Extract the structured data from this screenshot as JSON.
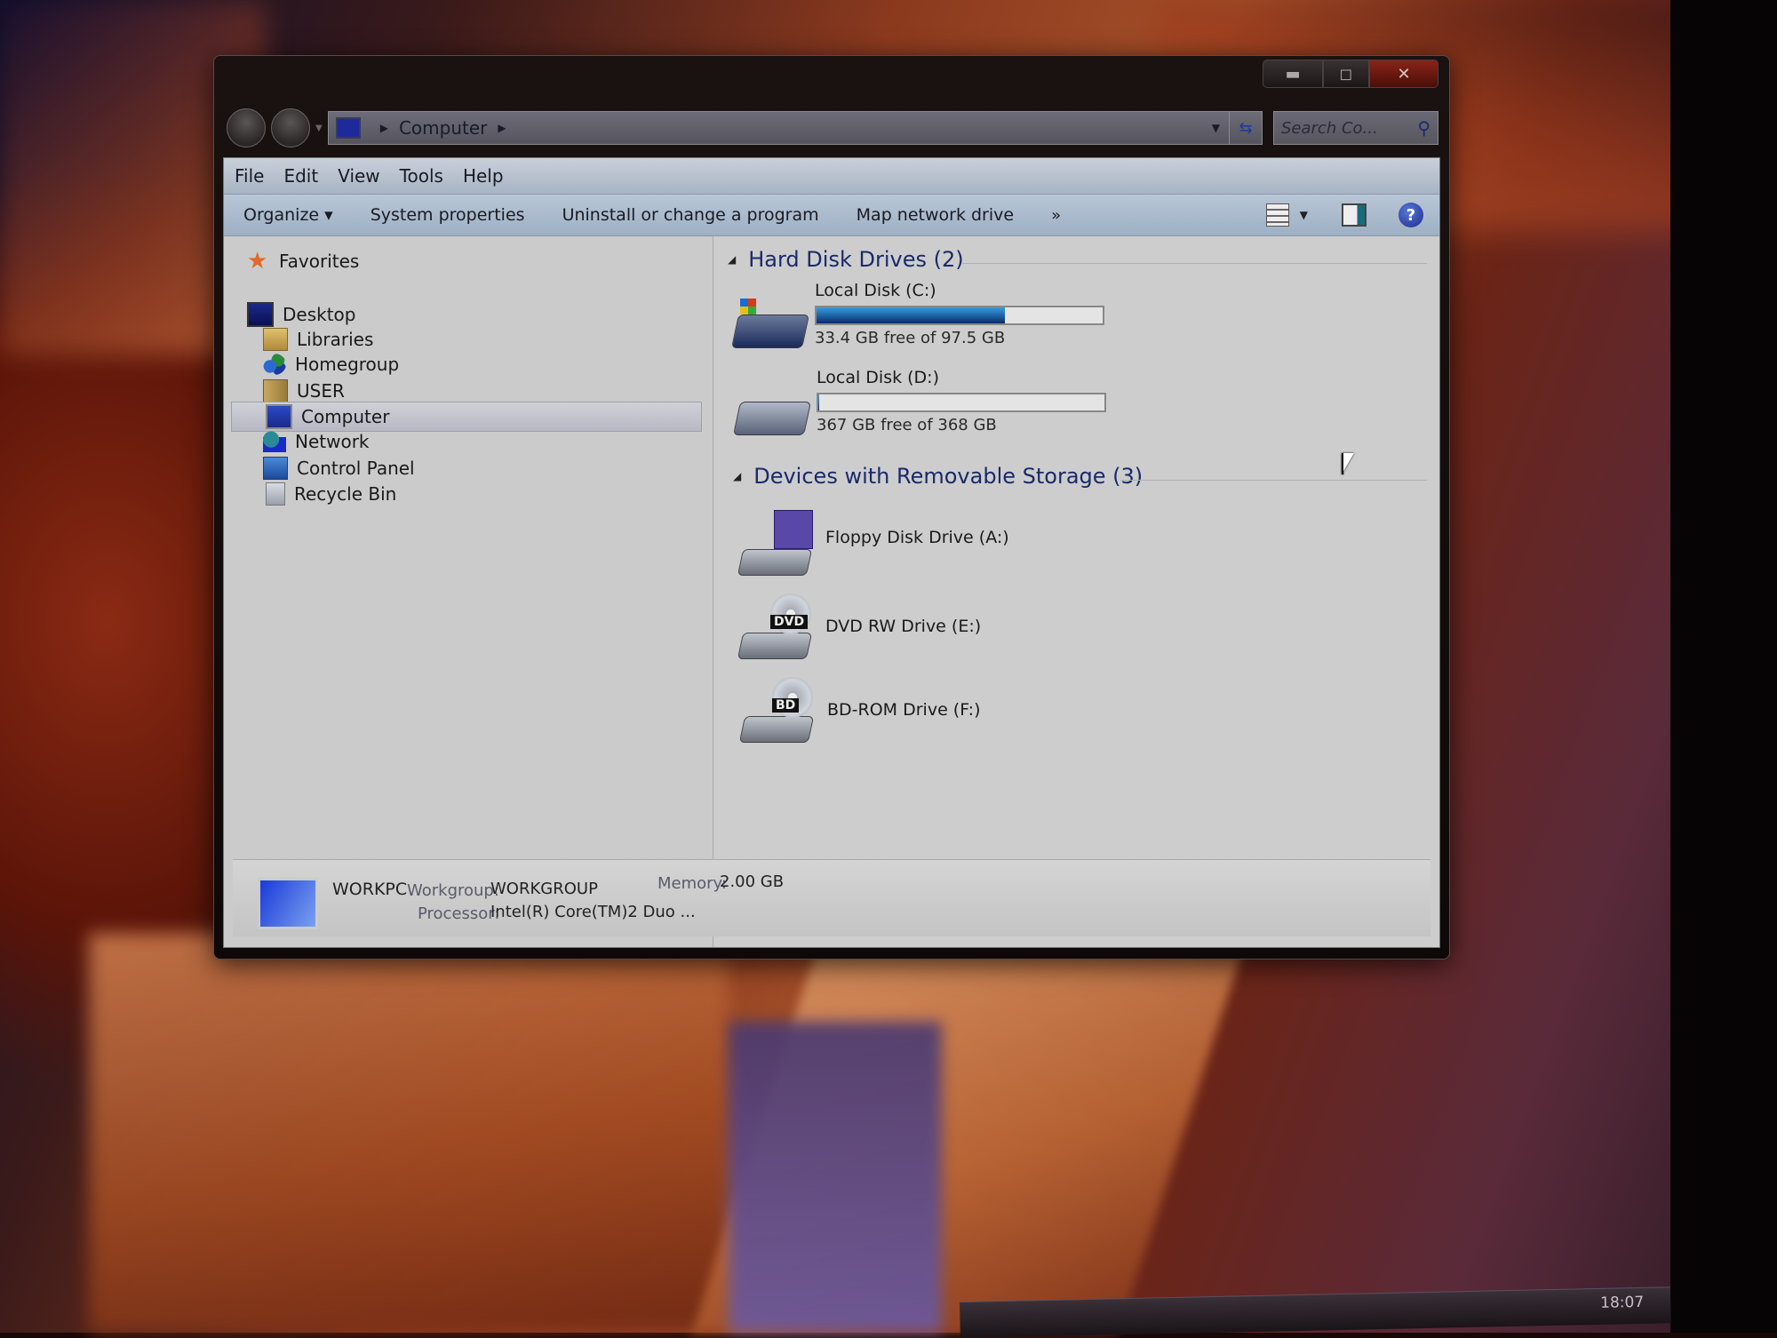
{
  "window": {
    "caption_buttons": {
      "minimize": "▬",
      "maximize": "◻",
      "close": "✕"
    },
    "address_bar": {
      "breadcrumb": [
        "Computer"
      ],
      "search_placeholder": "Search Co..."
    },
    "menu": [
      "File",
      "Edit",
      "View",
      "Tools",
      "Help"
    ],
    "commands": {
      "organize": "Organize ▾",
      "system_properties": "System properties",
      "uninstall": "Uninstall or change a program",
      "map_network_drive": "Map network drive",
      "more": "»",
      "help": "?"
    }
  },
  "sidebar": {
    "favorites": "Favorites",
    "items": [
      {
        "label": "Desktop",
        "icon": "desktop-icon"
      },
      {
        "label": "Libraries",
        "icon": "libraries-icon"
      },
      {
        "label": "Homegroup",
        "icon": "homegroup-icon"
      },
      {
        "label": "USER",
        "icon": "user-folder-icon"
      },
      {
        "label": "Computer",
        "icon": "computer-icon",
        "selected": true
      },
      {
        "label": "Network",
        "icon": "network-icon"
      },
      {
        "label": "Control Panel",
        "icon": "control-panel-icon"
      },
      {
        "label": "Recycle Bin",
        "icon": "recycle-bin-icon"
      }
    ]
  },
  "content": {
    "hard_disk_group": "Hard Disk Drives (2)",
    "hard_disks": [
      {
        "name": "Local Disk (C:)",
        "free_text": "33.4 GB free of 97.5 GB",
        "used_fraction": 0.657,
        "system": true
      },
      {
        "name": "Local Disk (D:)",
        "free_text": "367 GB free of 368 GB",
        "used_fraction": 0.003,
        "system": false
      }
    ],
    "removable_group": "Devices with Removable Storage (3)",
    "removable": [
      {
        "name": "Floppy Disk Drive (A:)",
        "type": "floppy"
      },
      {
        "name": "DVD RW Drive (E:)",
        "type": "dvd",
        "badge": "DVD"
      },
      {
        "name": "BD-ROM Drive (F:)",
        "type": "bd",
        "badge": "BD"
      }
    ]
  },
  "details": {
    "computer_name": "WORKPC",
    "workgroup_label": "Workgroup:",
    "workgroup_value": "WORKGROUP",
    "memory_label": "Memory:",
    "memory_value": "2.00 GB",
    "processor_label": "Processor:",
    "processor_value": "Intel(R) Core(TM)2 Duo ..."
  },
  "taskbar": {
    "clock": "18:07"
  },
  "colors": {
    "bar_fill": "#1a5a9a",
    "group_header": "#1a2a6a"
  }
}
